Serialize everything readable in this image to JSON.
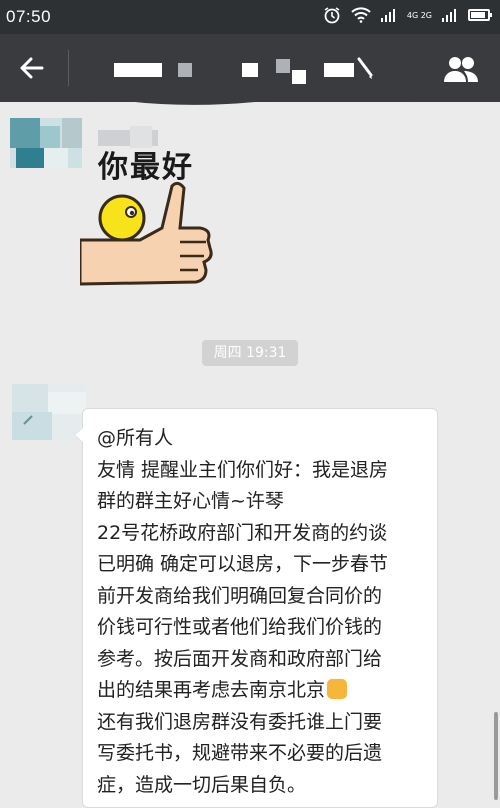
{
  "status_bar": {
    "time": "07:50",
    "network_label": "4G 2G"
  },
  "header": {
    "back_icon": "arrow-left-icon",
    "title_note": "",
    "contacts_icon": "people-icon"
  },
  "chat": {
    "sticker": {
      "text": "你最好"
    },
    "timestamp": "周四 19:31",
    "message": {
      "lines": [
        "@所有人",
        "友情 提醒业主们你们好：我是退房",
        "群的群主好心情~许琴",
        "22号花桥政府部门和开发商的约谈",
        "已明确 确定可以退房，下一步春节",
        "前开发商给我们明确回复合同价的",
        "价钱可行性或者他们给我们价钱的",
        "参考。按后面开发商和政府部门给",
        "出的结果再考虑去南京北京",
        "还有我们退房群没有委托谁上门要",
        "写委托书，规避带来不必要的后遗",
        "症，造成一切后果自负。"
      ]
    }
  },
  "colors": {
    "status_bar_bg": "#2d3133",
    "title_bar_bg": "#393b3f",
    "chat_bg": "#ebebeb",
    "bubble_bg": "#ffffff",
    "timestamp_bg": "#d2d2d2"
  }
}
